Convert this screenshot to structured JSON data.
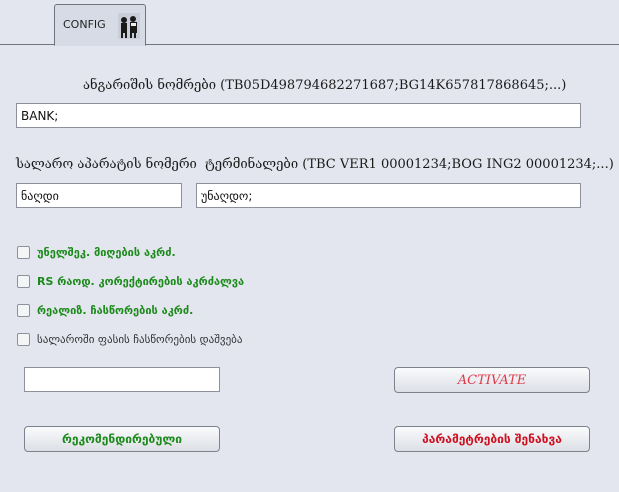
{
  "tab": {
    "label": "CONFIG",
    "icon": "people-icon"
  },
  "account_numbers": {
    "label": "ანგარიშის ნომრები  (TB05D498794682271687;BG14K657817868645;...)",
    "value": "BANK;"
  },
  "cash_register": {
    "label": "სალარო აპარატის ნომერი",
    "value": "ნაღდი"
  },
  "terminals": {
    "label": "ტერმინალები (TBC VER1 00001234;BOG ING2 00001234;...)",
    "value": "უნაღდო;"
  },
  "options": [
    {
      "label": "უნელშეკ. მიღების აკრძ.",
      "checked": false
    },
    {
      "label": "RS რაოდ. კორექტირების აკრძალვა",
      "checked": false
    },
    {
      "label": "რეალიზ. ჩასწორების აკრძ.",
      "checked": false
    },
    {
      "label": "სალაროში ფასის ჩასწორების დაშვება",
      "checked": false
    }
  ],
  "activation_code": {
    "value": ""
  },
  "buttons": {
    "activate": "ACTIVATE",
    "recommended": "რეკომენდირებული",
    "save_params": "პარამეტრების შენახვა"
  },
  "colors": {
    "green_label": "#1b8a1b",
    "red_label": "#d01020",
    "activate": "#e03a4a",
    "background": "#e3e6ee"
  }
}
